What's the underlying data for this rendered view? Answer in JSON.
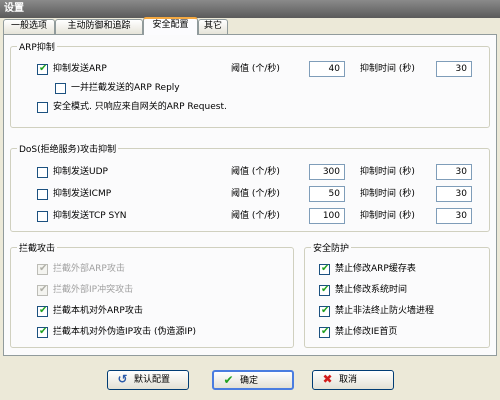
{
  "window": {
    "title": "设置"
  },
  "tabs": [
    {
      "label": "一般选项"
    },
    {
      "label": "主动防御和追踪"
    },
    {
      "label": "安全配置"
    },
    {
      "label": "其它"
    }
  ],
  "arp": {
    "title": "ARP抑制",
    "suppress_label": "抑制发送ARP",
    "suppress_checked": true,
    "block_reply_label": "一并拦截发送的ARP Reply",
    "block_reply_checked": false,
    "safe_mode_label": "安全模式. 只响应来自网关的ARP Request.",
    "safe_mode_checked": false,
    "threshold_label": "阈值 (个/秒)",
    "threshold_value": "40",
    "time_label": "抑制时间 (秒)",
    "time_value": "30"
  },
  "dos": {
    "title": "DoS(拒绝服务)攻击抑制",
    "rows": [
      {
        "label": "抑制发送UDP",
        "checked": false,
        "threshold_label": "阈值 (个/秒)",
        "threshold": "300",
        "time_label": "抑制时间 (秒)",
        "time": "30"
      },
      {
        "label": "抑制发送ICMP",
        "checked": false,
        "threshold_label": "阈值 (个/秒)",
        "threshold": "50",
        "time_label": "抑制时间 (秒)",
        "time": "30"
      },
      {
        "label": "抑制发送TCP SYN",
        "checked": false,
        "threshold_label": "阈值 (个/秒)",
        "threshold": "100",
        "time_label": "抑制时间 (秒)",
        "time": "30"
      }
    ]
  },
  "intercept": {
    "title": "拦截攻击",
    "items": [
      {
        "label": "拦截外部ARP攻击",
        "checked": true,
        "disabled": true
      },
      {
        "label": "拦截外部IP冲突攻击",
        "checked": true,
        "disabled": true
      },
      {
        "label": "拦截本机对外ARP攻击",
        "checked": true,
        "disabled": false
      },
      {
        "label": "拦截本机对外伪造IP攻击 (伪造源IP)",
        "checked": true,
        "disabled": false
      }
    ]
  },
  "protection": {
    "title": "安全防护",
    "items": [
      {
        "label": "禁止修改ARP缓存表",
        "checked": true
      },
      {
        "label": "禁止修改系统时间",
        "checked": true
      },
      {
        "label": "禁止非法终止防火墙进程",
        "checked": true
      },
      {
        "label": "禁止修改IE首页",
        "checked": true
      }
    ]
  },
  "buttons": {
    "default_label": "默认配置",
    "ok_label": "确定",
    "cancel_label": "取消"
  },
  "colors": {
    "ok_icon": "#21a121",
    "cancel_icon": "#d11c1c",
    "active_tab_accent": "#f5a941"
  }
}
